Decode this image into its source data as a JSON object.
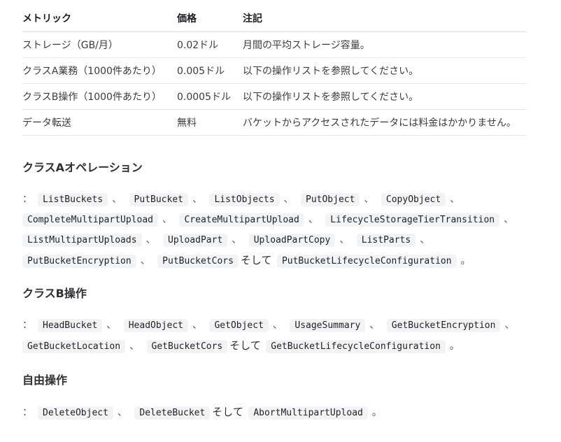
{
  "table": {
    "headers": [
      "メトリック",
      "価格",
      "注記"
    ],
    "rows": [
      [
        "ストレージ（GB/月）",
        "0.02ドル",
        "月間の平均ストレージ容量。"
      ],
      [
        "クラスA業務（1000件あたり）",
        "0.005ドル",
        "以下の操作リストを参照してください。"
      ],
      [
        "クラスB操作（1000件あたり）",
        "0.0005ドル",
        "以下の操作リストを参照してください。"
      ],
      [
        "データ転送",
        "無料",
        "バケットからアクセスされたデータには料金はかかりません。"
      ]
    ]
  },
  "sections": {
    "class_a": {
      "title": "クラスAオペレーション",
      "lead": "：",
      "ops": [
        "ListBuckets",
        "PutBucket",
        "ListObjects",
        "PutObject",
        "CopyObject",
        "CompleteMultipartUpload",
        "CreateMultipartUpload",
        "LifecycleStorageTierTransition",
        "ListMultipartUploads",
        "UploadPart",
        "UploadPartCopy",
        "ListParts",
        "PutBucketEncryption",
        "PutBucketCors",
        "PutBucketLifecycleConfiguration"
      ]
    },
    "class_b": {
      "title": "クラスB操作",
      "lead": "：",
      "ops": [
        "HeadBucket",
        "HeadObject",
        "GetObject",
        "UsageSummary",
        "GetBucketEncryption",
        "GetBucketLocation",
        "GetBucketCors",
        "GetBucketLifecycleConfiguration"
      ]
    },
    "free": {
      "title": "自由操作",
      "lead": "：",
      "ops": [
        "DeleteObject",
        "DeleteBucket",
        "AbortMultipartUpload"
      ]
    }
  },
  "separators": {
    "comma": "、",
    "and": "そして",
    "period": "。"
  }
}
